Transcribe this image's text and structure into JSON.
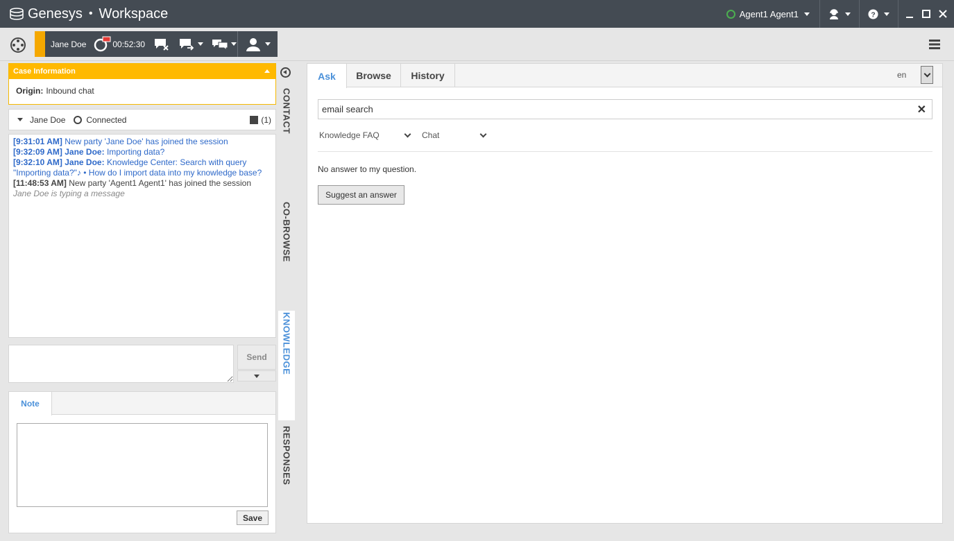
{
  "titlebar": {
    "brand": "Genesys",
    "separator": "•",
    "app": "Workspace",
    "agent_name": "Agent1 Agent1"
  },
  "toolbar": {
    "contact_name": "Jane Doe",
    "timer": "00:52:30"
  },
  "case_info": {
    "header": "Case Information",
    "origin_label": "Origin:",
    "origin_value": "Inbound chat"
  },
  "party": {
    "name": "Jane Doe",
    "status": "Connected",
    "count": "(1)"
  },
  "transcript": [
    {
      "time": "[9:31:01 AM]",
      "speaker": "",
      "text": "New party 'Jane Doe' has joined the session",
      "type": "sys-blue"
    },
    {
      "time": "[9:32:09 AM]",
      "speaker": "Jane Doe:",
      "text": "Importing data?",
      "type": "msg"
    },
    {
      "time": "[9:32:10 AM]",
      "speaker": "Jane Doe:",
      "text": "Knowledge Center: Search with query \"Importing data?\"♪ • How do I import data into my knowledge base?",
      "type": "msg"
    },
    {
      "time": "[11:48:53 AM]",
      "speaker": "",
      "text": "New party 'Agent1 Agent1' has joined the session",
      "type": "sys"
    }
  ],
  "typing_text": "Jane Doe is typing a message",
  "composer": {
    "send_label": "Send"
  },
  "note": {
    "tab_label": "Note",
    "save_label": "Save"
  },
  "vertical_tabs": {
    "contact": "CONTACT",
    "cobrowse": "CO-BROWSE",
    "knowledge": "KNOWLEDGE",
    "responses": "RESPONSES"
  },
  "knowledge": {
    "tabs": [
      "Ask",
      "Browse",
      "History"
    ],
    "language": "en",
    "search_value": "email search",
    "filter_kb": "Knowledge FAQ",
    "filter_channel": "Chat",
    "empty_text": "No answer to my question.",
    "suggest_label": "Suggest an answer"
  },
  "colors": {
    "accent": "#ffb900",
    "titlebar": "#444b53",
    "link": "#2e69c9",
    "active_tab": "#4a90d9"
  }
}
